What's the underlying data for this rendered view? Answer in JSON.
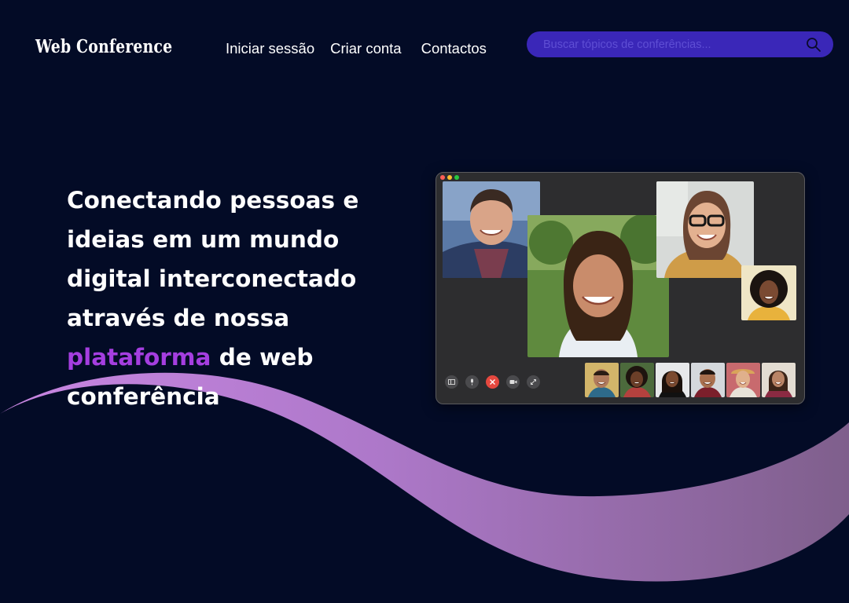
{
  "header": {
    "logo": "Web Conference",
    "nav": {
      "login": "Iniciar sessão",
      "register": "Criar conta",
      "contacts": "Contactos"
    },
    "search": {
      "placeholder": "Buscar tópicos de conferências...",
      "icon": "search-icon"
    }
  },
  "hero": {
    "text_before": "Conectando pessoas e ideias em um mundo digital interconectado através de nossa",
    "highlight": "plataforma",
    "text_after": "de web conferência"
  },
  "colors": {
    "background": "#030b26",
    "search_bg": "#3a27b8",
    "highlight": "#a53ee0",
    "wave_start": "#b87ad6",
    "wave_end": "#8a5f93"
  },
  "mockup": {
    "window_controls": [
      "close",
      "minimize",
      "maximize"
    ],
    "controls": [
      "sidebar-icon",
      "mute-icon",
      "end-call-icon",
      "camera-icon",
      "fullscreen-icon"
    ],
    "participant_thumbnails": 6
  }
}
